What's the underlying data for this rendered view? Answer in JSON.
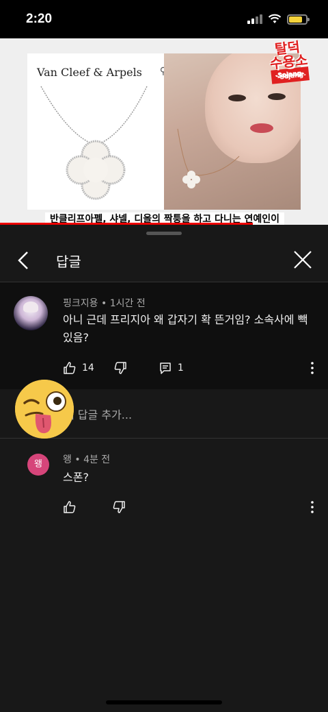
{
  "status_bar": {
    "time": "2:20"
  },
  "video": {
    "brand_text": "Van Cleef & Arpels",
    "watermark_line1": "탈덕",
    "watermark_line2": "수용소",
    "watermark_sub": "-Sojang-",
    "caption": "반클리프아펠, 샤넬, 디올의 짝퉁을 하고 다니는 연예인이",
    "progress": 0.77
  },
  "sheet": {
    "title": "답글"
  },
  "parent_comment": {
    "author": "핑크지용",
    "time": "1시간 전",
    "text": "아니 근데 프리지아 왜 갑자기 확 뜬거임? 소속사에 빽있음?",
    "likes": "14",
    "replies": "1"
  },
  "add_reply": {
    "placeholder": "개 답글 추가..."
  },
  "reply": {
    "author": "왱",
    "avatar_letter": "왱",
    "time": "4분 전",
    "text": "스폰?"
  },
  "colors": {
    "accent_red": "#e00000",
    "reply_avatar": "#d6457a",
    "battery": "#f5d33b"
  }
}
